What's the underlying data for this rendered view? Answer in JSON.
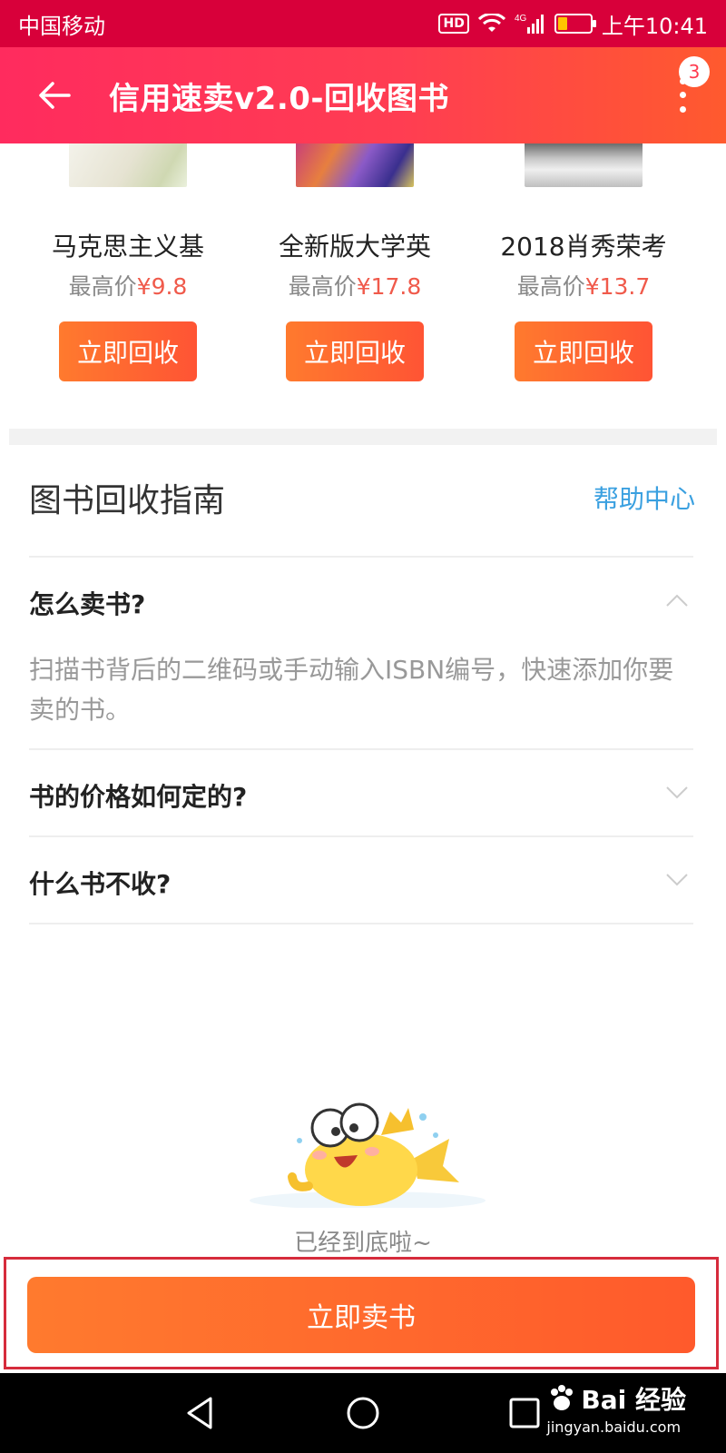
{
  "status_bar": {
    "carrier": "中国移动",
    "network": "4G",
    "hd": "HD",
    "time": "上午10:41",
    "battery_level": 0.3
  },
  "header": {
    "title": "信用速卖v2.0-回收图书",
    "back_icon": "arrow-left-icon",
    "more_icon": "more-vertical-icon",
    "notification_count": "3"
  },
  "books": [
    {
      "title": "马克思主义基",
      "price_prefix": "最高价",
      "price": "¥9.8",
      "button": "立即回收"
    },
    {
      "title": "全新版大学英",
      "price_prefix": "最高价",
      "price": "¥17.8",
      "button": "立即回收"
    },
    {
      "title": "2018肖秀荣考",
      "price_prefix": "最高价",
      "price": "¥13.7",
      "button": "立即回收"
    }
  ],
  "guide": {
    "title": "图书回收指南",
    "help_link": "帮助中心",
    "faqs": [
      {
        "question": "怎么卖书?",
        "expanded": true,
        "answer": "扫描书背后的二维码或手动输入ISBN编号，快速添加你要卖的书。"
      },
      {
        "question": "书的价格如何定的?",
        "expanded": false
      },
      {
        "question": "什么书不收?",
        "expanded": false
      }
    ]
  },
  "footer": {
    "end_text": "已经到底啦~",
    "sell_button": "立即卖书"
  },
  "watermark": {
    "main": "Bai 经验",
    "sub": "jingyan.baidu.com"
  },
  "colors": {
    "status_bar": "#d8003a",
    "header_start": "#ff2b5e",
    "header_end": "#ff5a2e",
    "button_orange": "#ff6a30",
    "price_red": "#f05a4b",
    "link_blue": "#3aa0e0",
    "highlight_frame": "#d62b3c"
  }
}
